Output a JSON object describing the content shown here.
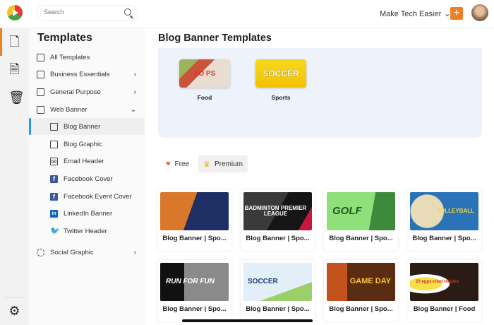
{
  "header": {
    "search_placeholder": "Search",
    "org_name": "Make Tech Easier",
    "org_chevron": "⌄",
    "add_label": "+"
  },
  "rail": {
    "icons": [
      "document-icon",
      "text-document-icon",
      "trash-icon",
      "gear-icon"
    ]
  },
  "sidebar": {
    "title": "Templates",
    "items": [
      {
        "label": "All Templates",
        "chevron": ""
      },
      {
        "label": "Business Essentials",
        "chevron": "›"
      },
      {
        "label": "General Purpose",
        "chevron": "›"
      },
      {
        "label": "Web Banner",
        "chevron": "⌄"
      },
      {
        "label": "Blog Banner",
        "chevron": ""
      },
      {
        "label": "Blog Graphic",
        "chevron": ""
      },
      {
        "label": "Email Header",
        "chevron": ""
      },
      {
        "label": "Facebook Cover",
        "chevron": ""
      },
      {
        "label": "Facebook Event Cover",
        "chevron": ""
      },
      {
        "label": "LinkedIn Banner",
        "chevron": ""
      },
      {
        "label": "Twitter Header",
        "chevron": ""
      },
      {
        "label": "Social Graphic",
        "chevron": "›"
      }
    ]
  },
  "main": {
    "title": "Blog Banner Templates",
    "categories": [
      {
        "label": "Food",
        "art": "SO PS"
      },
      {
        "label": "Sports",
        "art": "SOCCER"
      }
    ],
    "filters": [
      {
        "label": "Free",
        "icon": "♥"
      },
      {
        "label": "Premium",
        "icon": "♛"
      }
    ],
    "cards": [
      {
        "label": "Blog Banner | Spo...",
        "art": ""
      },
      {
        "label": "Blog Banner | Spo...",
        "art": "BADMINTON PREMIER LEAGUE"
      },
      {
        "label": "Blog Banner | Spo...",
        "art": "GOLF"
      },
      {
        "label": "Blog Banner | Spo...",
        "art": "VOLLEYBALL"
      },
      {
        "label": "Blog Banner | Spo...",
        "art": "RUN FOR FUN"
      },
      {
        "label": "Blog Banner | Spo...",
        "art": "SOCCER"
      },
      {
        "label": "Blog Banner | Spo...",
        "art": "GAME DAY"
      },
      {
        "label": "Blog Banner | Food",
        "art": "20 eggs-cited recipes"
      }
    ]
  }
}
